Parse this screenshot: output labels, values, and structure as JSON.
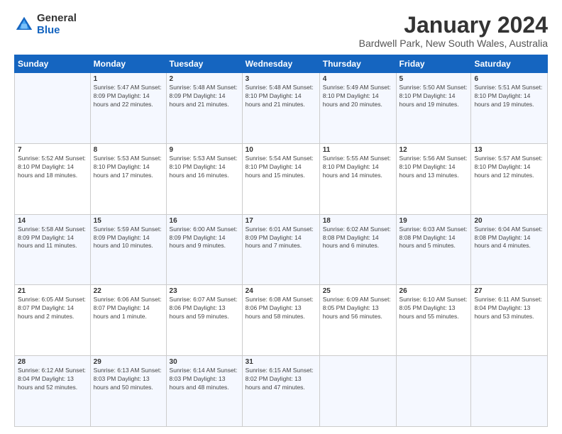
{
  "logo": {
    "general": "General",
    "blue": "Blue"
  },
  "title": "January 2024",
  "location": "Bardwell Park, New South Wales, Australia",
  "days_header": [
    "Sunday",
    "Monday",
    "Tuesday",
    "Wednesday",
    "Thursday",
    "Friday",
    "Saturday"
  ],
  "weeks": [
    [
      {
        "day": "",
        "info": ""
      },
      {
        "day": "1",
        "info": "Sunrise: 5:47 AM\nSunset: 8:09 PM\nDaylight: 14 hours\nand 22 minutes."
      },
      {
        "day": "2",
        "info": "Sunrise: 5:48 AM\nSunset: 8:09 PM\nDaylight: 14 hours\nand 21 minutes."
      },
      {
        "day": "3",
        "info": "Sunrise: 5:48 AM\nSunset: 8:10 PM\nDaylight: 14 hours\nand 21 minutes."
      },
      {
        "day": "4",
        "info": "Sunrise: 5:49 AM\nSunset: 8:10 PM\nDaylight: 14 hours\nand 20 minutes."
      },
      {
        "day": "5",
        "info": "Sunrise: 5:50 AM\nSunset: 8:10 PM\nDaylight: 14 hours\nand 19 minutes."
      },
      {
        "day": "6",
        "info": "Sunrise: 5:51 AM\nSunset: 8:10 PM\nDaylight: 14 hours\nand 19 minutes."
      }
    ],
    [
      {
        "day": "7",
        "info": "Sunrise: 5:52 AM\nSunset: 8:10 PM\nDaylight: 14 hours\nand 18 minutes."
      },
      {
        "day": "8",
        "info": "Sunrise: 5:53 AM\nSunset: 8:10 PM\nDaylight: 14 hours\nand 17 minutes."
      },
      {
        "day": "9",
        "info": "Sunrise: 5:53 AM\nSunset: 8:10 PM\nDaylight: 14 hours\nand 16 minutes."
      },
      {
        "day": "10",
        "info": "Sunrise: 5:54 AM\nSunset: 8:10 PM\nDaylight: 14 hours\nand 15 minutes."
      },
      {
        "day": "11",
        "info": "Sunrise: 5:55 AM\nSunset: 8:10 PM\nDaylight: 14 hours\nand 14 minutes."
      },
      {
        "day": "12",
        "info": "Sunrise: 5:56 AM\nSunset: 8:10 PM\nDaylight: 14 hours\nand 13 minutes."
      },
      {
        "day": "13",
        "info": "Sunrise: 5:57 AM\nSunset: 8:10 PM\nDaylight: 14 hours\nand 12 minutes."
      }
    ],
    [
      {
        "day": "14",
        "info": "Sunrise: 5:58 AM\nSunset: 8:09 PM\nDaylight: 14 hours\nand 11 minutes."
      },
      {
        "day": "15",
        "info": "Sunrise: 5:59 AM\nSunset: 8:09 PM\nDaylight: 14 hours\nand 10 minutes."
      },
      {
        "day": "16",
        "info": "Sunrise: 6:00 AM\nSunset: 8:09 PM\nDaylight: 14 hours\nand 9 minutes."
      },
      {
        "day": "17",
        "info": "Sunrise: 6:01 AM\nSunset: 8:09 PM\nDaylight: 14 hours\nand 7 minutes."
      },
      {
        "day": "18",
        "info": "Sunrise: 6:02 AM\nSunset: 8:08 PM\nDaylight: 14 hours\nand 6 minutes."
      },
      {
        "day": "19",
        "info": "Sunrise: 6:03 AM\nSunset: 8:08 PM\nDaylight: 14 hours\nand 5 minutes."
      },
      {
        "day": "20",
        "info": "Sunrise: 6:04 AM\nSunset: 8:08 PM\nDaylight: 14 hours\nand 4 minutes."
      }
    ],
    [
      {
        "day": "21",
        "info": "Sunrise: 6:05 AM\nSunset: 8:07 PM\nDaylight: 14 hours\nand 2 minutes."
      },
      {
        "day": "22",
        "info": "Sunrise: 6:06 AM\nSunset: 8:07 PM\nDaylight: 14 hours\nand 1 minute."
      },
      {
        "day": "23",
        "info": "Sunrise: 6:07 AM\nSunset: 8:06 PM\nDaylight: 13 hours\nand 59 minutes."
      },
      {
        "day": "24",
        "info": "Sunrise: 6:08 AM\nSunset: 8:06 PM\nDaylight: 13 hours\nand 58 minutes."
      },
      {
        "day": "25",
        "info": "Sunrise: 6:09 AM\nSunset: 8:05 PM\nDaylight: 13 hours\nand 56 minutes."
      },
      {
        "day": "26",
        "info": "Sunrise: 6:10 AM\nSunset: 8:05 PM\nDaylight: 13 hours\nand 55 minutes."
      },
      {
        "day": "27",
        "info": "Sunrise: 6:11 AM\nSunset: 8:04 PM\nDaylight: 13 hours\nand 53 minutes."
      }
    ],
    [
      {
        "day": "28",
        "info": "Sunrise: 6:12 AM\nSunset: 8:04 PM\nDaylight: 13 hours\nand 52 minutes."
      },
      {
        "day": "29",
        "info": "Sunrise: 6:13 AM\nSunset: 8:03 PM\nDaylight: 13 hours\nand 50 minutes."
      },
      {
        "day": "30",
        "info": "Sunrise: 6:14 AM\nSunset: 8:03 PM\nDaylight: 13 hours\nand 48 minutes."
      },
      {
        "day": "31",
        "info": "Sunrise: 6:15 AM\nSunset: 8:02 PM\nDaylight: 13 hours\nand 47 minutes."
      },
      {
        "day": "",
        "info": ""
      },
      {
        "day": "",
        "info": ""
      },
      {
        "day": "",
        "info": ""
      }
    ]
  ]
}
